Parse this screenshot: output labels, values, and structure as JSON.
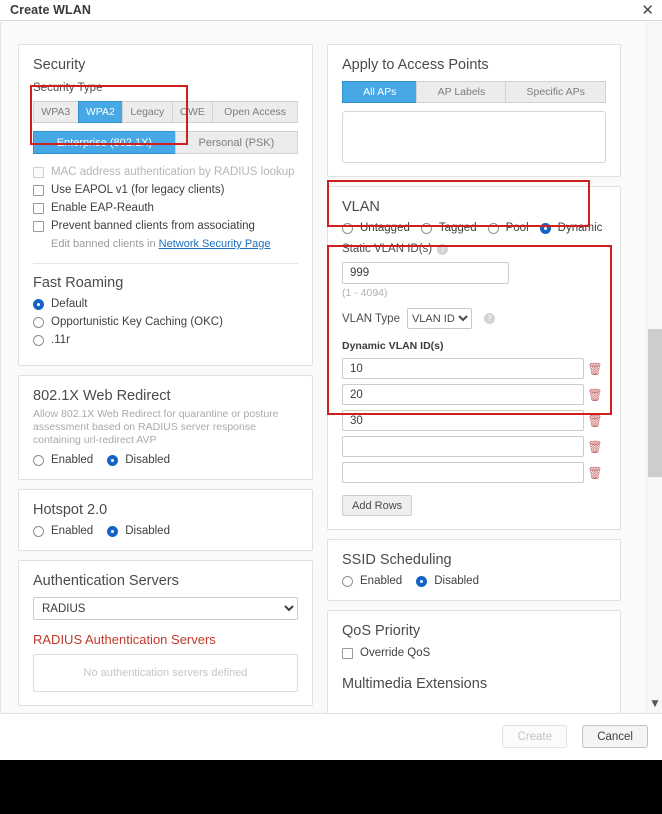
{
  "window": {
    "title": "Create WLAN",
    "close_icon": "close-icon"
  },
  "security": {
    "heading": "Security",
    "type_label": "Security Type",
    "types": [
      "WPA3",
      "WPA2",
      "Legacy",
      "OWE",
      "Open Access"
    ],
    "type_selected": "WPA2",
    "modes": [
      "Enterprise (802.1X)",
      "Personal (PSK)"
    ],
    "mode_selected": "Enterprise (802.1X)",
    "checkboxes": [
      {
        "label": "MAC address authentication by RADIUS lookup",
        "checked": false,
        "disabled": true
      },
      {
        "label": "Use EAPOL v1 (for legacy clients)",
        "checked": false,
        "disabled": false
      },
      {
        "label": "Enable EAP-Reauth",
        "checked": false,
        "disabled": false
      },
      {
        "label": "Prevent banned clients from associating",
        "checked": false,
        "disabled": false
      }
    ],
    "banned_note_prefix": "Edit banned clients in ",
    "banned_note_link": "Network Security Page"
  },
  "fast_roaming": {
    "heading": "Fast Roaming",
    "options": [
      "Default",
      "Opportunistic Key Caching (OKC)",
      ".11r"
    ],
    "selected": "Default"
  },
  "web_redirect": {
    "heading": "802.1X Web Redirect",
    "description": "Allow 802.1X Web Redirect for quarantine or posture assessment based on RADIUS server response containing url-redirect AVP",
    "options": [
      "Enabled",
      "Disabled"
    ],
    "selected": "Disabled"
  },
  "hotspot": {
    "heading": "Hotspot 2.0",
    "options": [
      "Enabled",
      "Disabled"
    ],
    "selected": "Disabled"
  },
  "auth_servers": {
    "heading": "Authentication Servers",
    "select_value": "RADIUS",
    "select_options": [
      "RADIUS"
    ],
    "subheading": "RADIUS Authentication Servers",
    "empty_text": "No authentication servers defined"
  },
  "access_points": {
    "heading": "Apply to Access Points",
    "tabs": [
      "All APs",
      "AP Labels",
      "Specific APs"
    ],
    "tab_selected": "All APs"
  },
  "vlan": {
    "heading": "VLAN",
    "options": [
      "Untagged",
      "Tagged",
      "Pool",
      "Dynamic"
    ],
    "selected": "Dynamic",
    "static_label": "Static VLAN ID(s)",
    "static_help_icon": "help-icon",
    "static_value": "999",
    "static_range": "(1 - 4094)",
    "type_label": "VLAN Type",
    "type_value": "VLAN ID",
    "type_options": [
      "VLAN ID"
    ],
    "type_help_icon": "help-icon",
    "dynamic_label": "Dynamic VLAN ID(s)",
    "dynamic_rows": [
      "10",
      "20",
      "30",
      "",
      ""
    ],
    "delete_icon": "trash-icon",
    "add_rows_label": "Add Rows"
  },
  "ssid_scheduling": {
    "heading": "SSID Scheduling",
    "options": [
      "Enabled",
      "Disabled"
    ],
    "selected": "Disabled"
  },
  "qos": {
    "heading": "QoS Priority",
    "override_label": "Override QoS",
    "override_checked": false
  },
  "multimedia": {
    "heading": "Multimedia Extensions"
  },
  "footer": {
    "create_label": "Create",
    "cancel_label": "Cancel"
  },
  "scrollbar": {
    "down_arrow_icon": "chevron-down-icon"
  },
  "colors": {
    "accent_blue": "#46a8e5",
    "radio_blue": "#1562c6",
    "annotation_red": "#d01f1f",
    "warning_red": "#c0392b"
  }
}
